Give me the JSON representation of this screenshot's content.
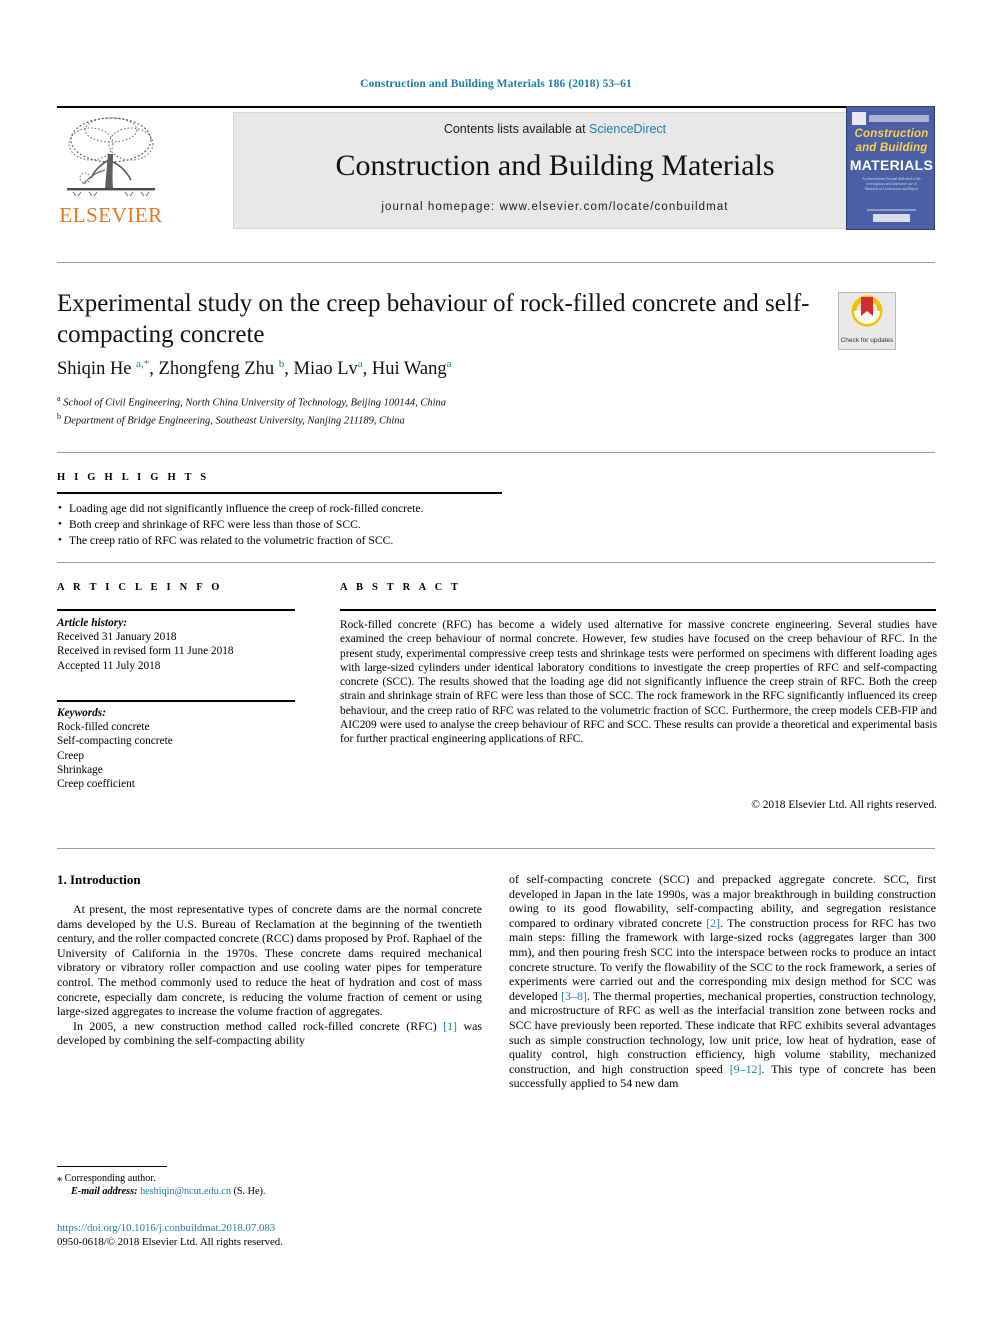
{
  "running_head": "Construction and Building Materials 186 (2018) 53–61",
  "masthead": {
    "contents_prefix": "Contents lists available at ",
    "sciencedirect": "ScienceDirect",
    "journal_name": "Construction and Building Materials",
    "homepage": "journal homepage: www.elsevier.com/locate/conbuildmat",
    "publisher": "ELSEVIER",
    "cover": {
      "line1": "Construction",
      "line2": "and Building",
      "line3": "MATERIALS",
      "blurb": "An International Journal dedicated to the investigation and innovative use of Materials in Construction and Repair"
    }
  },
  "article": {
    "title": "Experimental study on the creep behaviour of rock-filled concrete and self-compacting concrete",
    "authors_html": "Shiqin He <sup>a,*</sup>, Zhongfeng Zhu <sup>b</sup>, Miao Lv<sup>a</sup>, Hui Wang<sup>a</sup>",
    "affiliation_a": "School of Civil Engineering, North China University of Technology, Beijing 100144, China",
    "affiliation_b": "Department of Bridge Engineering, Southeast University, Nanjing 211189, China",
    "crossmark_label": "Check for updates"
  },
  "highlights": {
    "label": "H I G H L I G H T S",
    "items": [
      "Loading age did not significantly influence the creep of rock-filled concrete.",
      "Both creep and shrinkage of RFC were less than those of SCC.",
      "The creep ratio of RFC was related to the volumetric fraction of SCC."
    ]
  },
  "article_info": {
    "label": "A R T I C L E   I N F O",
    "history_label": "Article history:",
    "history": [
      "Received 31 January 2018",
      "Received in revised form 11 June 2018",
      "Accepted 11 July 2018"
    ],
    "keywords_label": "Keywords:",
    "keywords": [
      "Rock-filled concrete",
      "Self-compacting concrete",
      "Creep",
      "Shrinkage",
      "Creep coefficient"
    ]
  },
  "abstract": {
    "label": "A B S T R A C T",
    "text": "Rock-filled concrete (RFC) has become a widely used alternative for massive concrete engineering. Several studies have examined the creep behaviour of normal concrete. However, few studies have focused on the creep behaviour of RFC. In the present study, experimental compressive creep tests and shrinkage tests were performed on specimens with different loading ages with large-sized cylinders under identical laboratory conditions to investigate the creep properties of RFC and self-compacting concrete (SCC). The results showed that the loading age did not significantly influence the creep strain of RFC. Both the creep strain and shrinkage strain of RFC were less than those of SCC. The rock framework in the RFC significantly influenced its creep behaviour, and the creep ratio of RFC was related to the volumetric fraction of SCC. Furthermore, the creep models CEB-FIP and AIC209 were used to analyse the creep behaviour of RFC and SCC. These results can provide a theoretical and experimental basis for further practical engineering applications of RFC.",
    "copyright": "© 2018 Elsevier Ltd. All rights reserved."
  },
  "body": {
    "section_heading": "1. Introduction",
    "left_paragraph_1": "At present, the most representative types of concrete dams are the normal concrete dams developed by the U.S. Bureau of Reclamation at the beginning of the twentieth century, and the roller compacted concrete (RCC) dams proposed by Prof. Raphael of the University of California in the 1970s. These concrete dams required mechanical vibratory or vibratory roller compaction and use cooling water pipes for temperature control. The method commonly used to reduce the heat of hydration and cost of mass concrete, especially dam concrete, is reducing the volume fraction of cement or using large-sized aggregates to increase the volume fraction of aggregates.",
    "left_paragraph_2_pre": "In 2005, a new construction method called rock-filled concrete (RFC) ",
    "left_paragraph_2_ref": "[1]",
    "left_paragraph_2_post": " was developed by combining the self-compacting ability",
    "right_paragraph_1_a": "of self-compacting concrete (SCC) and prepacked aggregate concrete. SCC, first developed in Japan in the late 1990s, was a major breakthrough in building construction owing to its good flowability, self-compacting ability, and segregation resistance compared to ordinary vibrated concrete ",
    "right_ref_1": "[2]",
    "right_paragraph_1_b": ". The construction process for RFC has two main steps: filling the framework with large-sized rocks (aggregates larger than 300 mm), and then pouring fresh SCC into the interspace between rocks to produce an intact concrete structure. To verify the flowability of the SCC to the rock framework, a series of experiments were carried out and the corresponding mix design method for SCC was developed ",
    "right_ref_2": "[3–8]",
    "right_paragraph_1_c": ". The thermal properties, mechanical properties, construction technology, and microstructure of RFC as well as the interfacial transition zone between rocks and SCC have previously been reported. These indicate that RFC exhibits several advantages such as simple construction technology, low unit price, low heat of hydration, ease of quality control, high construction efficiency, high volume stability, mechanized construction, and high construction speed ",
    "right_ref_3": "[9–12]",
    "right_paragraph_1_d": ". This type of concrete has been successfully applied to 54 new dam"
  },
  "footer": {
    "corresponding_marker": "⁎",
    "corresponding_text": "Corresponding author.",
    "email_label": "E-mail address:",
    "email": "heshiqin@ncut.edu.cn",
    "email_suffix": "(S. He).",
    "doi": "https://doi.org/10.1016/j.conbuildmat.2018.07.083",
    "issn_line": "0950-0618/© 2018 Elsevier Ltd. All rights reserved."
  },
  "colors": {
    "link": "#1a7fa8",
    "elsevier_orange": "#E87722",
    "cover_blue": "#4a5fa5"
  }
}
